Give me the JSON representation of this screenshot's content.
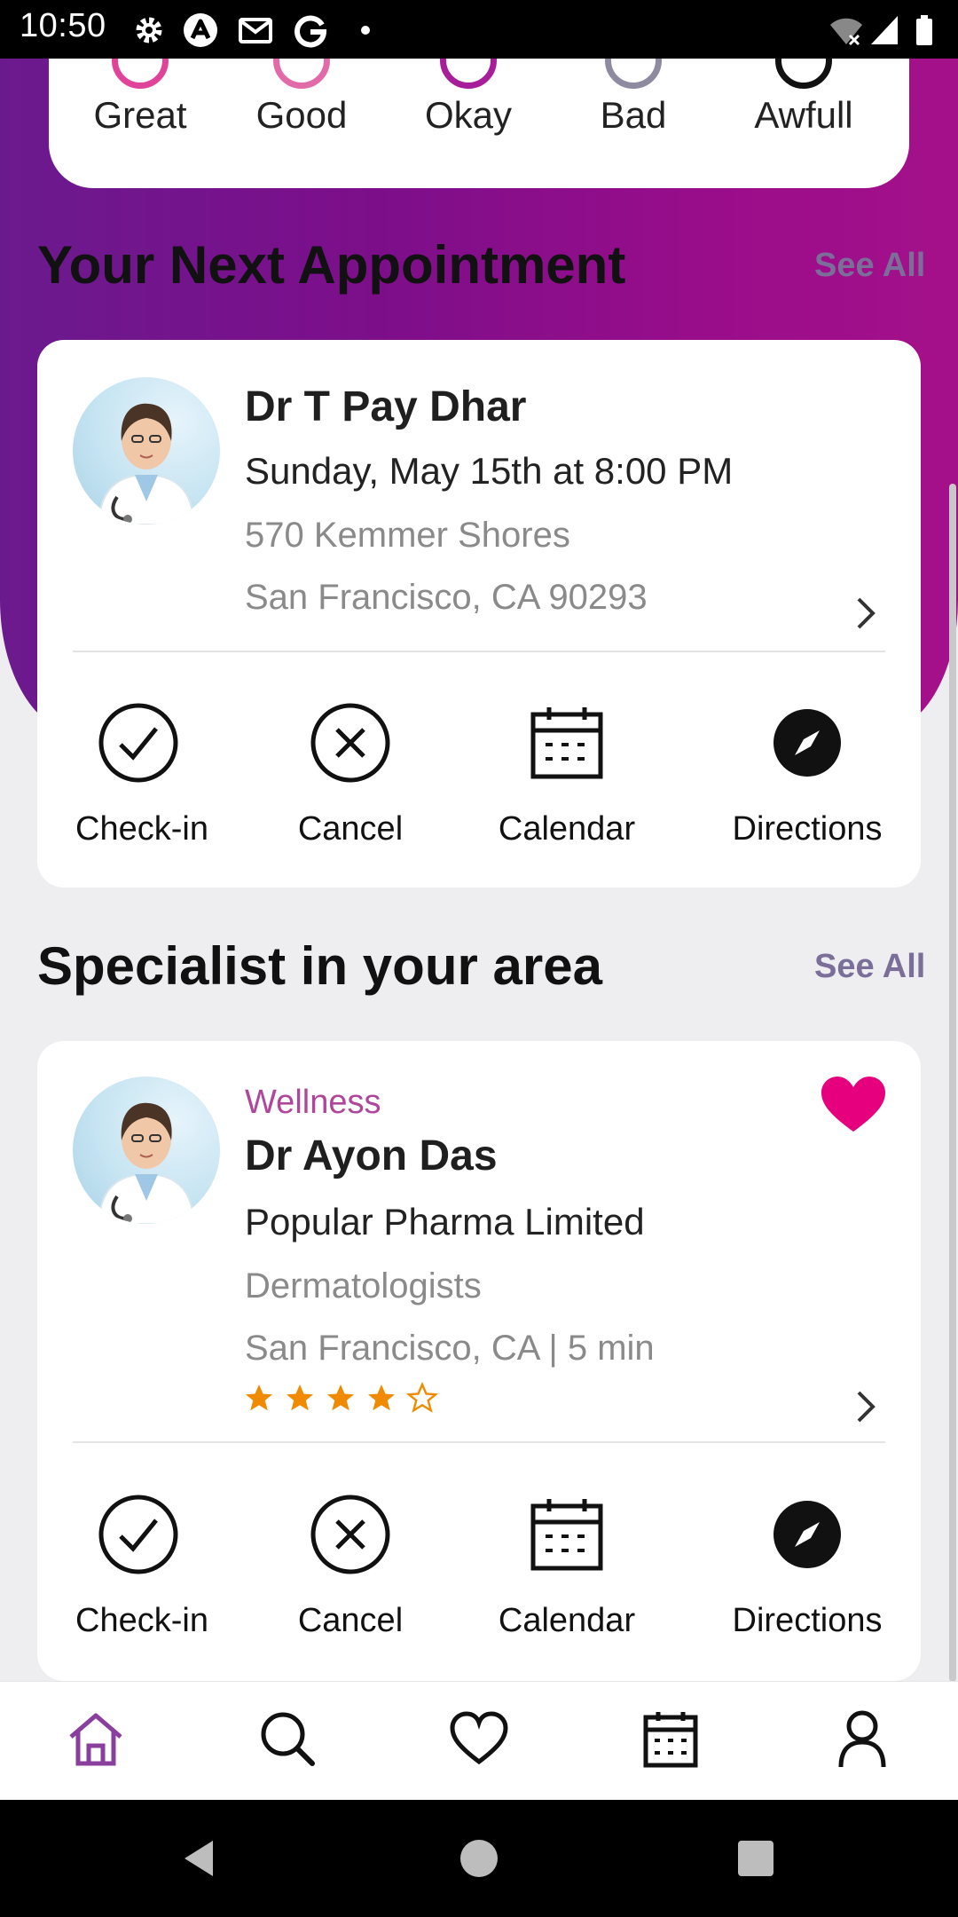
{
  "status_bar": {
    "time": "10:50",
    "icons": [
      "gear-icon",
      "app-a-icon",
      "gmail-icon",
      "google-icon",
      "dot-icon",
      "wifi-icon",
      "cellular-icon",
      "battery-icon"
    ]
  },
  "mood": {
    "options": [
      {
        "label": "Great",
        "color": "#e0449a"
      },
      {
        "label": "Good",
        "color": "#e36aa8"
      },
      {
        "label": "Okay",
        "color": "#a81e9a"
      },
      {
        "label": "Bad",
        "color": "#8e8aa0"
      },
      {
        "label": "Awfull",
        "color": "#111111"
      }
    ]
  },
  "appointment_section": {
    "title": "Your Next Appointment",
    "see_all": "See All",
    "card": {
      "doctor_name": "Dr T Pay Dhar",
      "datetime": "Sunday, May 15th at 8:00 PM",
      "address_line1": "570 Kemmer Shores",
      "address_line2": "San Francisco, CA 90293"
    },
    "actions": [
      "Check-in",
      "Cancel",
      "Calendar",
      "Directions"
    ]
  },
  "specialist_section": {
    "title": "Specialist in your area",
    "see_all": "See All",
    "card": {
      "category": "Wellness",
      "doctor_name": "Dr Ayon Das",
      "company": "Popular Pharma Limited",
      "specialty": "Dermatologists",
      "location": "San Francisco, CA | 5 min",
      "rating": 4,
      "rating_max": 5
    },
    "actions": [
      "Check-in",
      "Cancel",
      "Calendar",
      "Directions"
    ]
  },
  "bottom_nav": {
    "items": [
      "home-icon",
      "search-icon",
      "heart-icon",
      "calendar-icon",
      "profile-icon"
    ],
    "active": "home-icon"
  },
  "colors": {
    "accent": "#8a3f9e",
    "heart": "#e6007e",
    "star": "#f08a00",
    "category": "#b0469c"
  }
}
